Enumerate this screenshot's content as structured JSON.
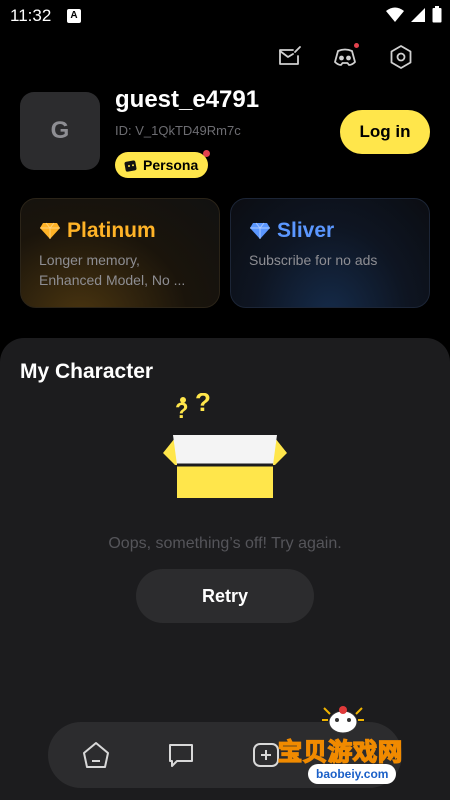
{
  "status_bar": {
    "time": "11:32",
    "a_indicator": "A",
    "icons": [
      "wifi-icon",
      "signal-icon",
      "battery-icon"
    ]
  },
  "header_icons": [
    "mail-edit-icon",
    "discord-icon",
    "settings-icon"
  ],
  "profile": {
    "avatar_initial": "G",
    "username": "guest_e4791",
    "user_id": "ID: V_1QkTD49Rm7c",
    "persona_label": "Persona",
    "login_label": "Log in"
  },
  "plans": [
    {
      "name": "Platinum",
      "description": "Longer memory,\nEnhanced Model, No ...",
      "icon": "gem-gold-icon",
      "color": "#ffb327"
    },
    {
      "name": "Sliver",
      "description": "Subscribe for no ads",
      "icon": "gem-blue-icon",
      "color": "#5b97ff"
    }
  ],
  "my_character": {
    "title": "My Character",
    "error_message": "Oops, something’s off! Try again.",
    "retry_label": "Retry"
  },
  "bottom_nav": [
    "home-icon",
    "chat-icon",
    "create-icon"
  ],
  "watermark": {
    "title": "宝贝游戏网",
    "url": "baobeiy.com"
  },
  "colors": {
    "accent": "#ffe64b",
    "background": "#000000",
    "sheet": "#1c1c1e",
    "badge_dot": "#e3434e"
  }
}
